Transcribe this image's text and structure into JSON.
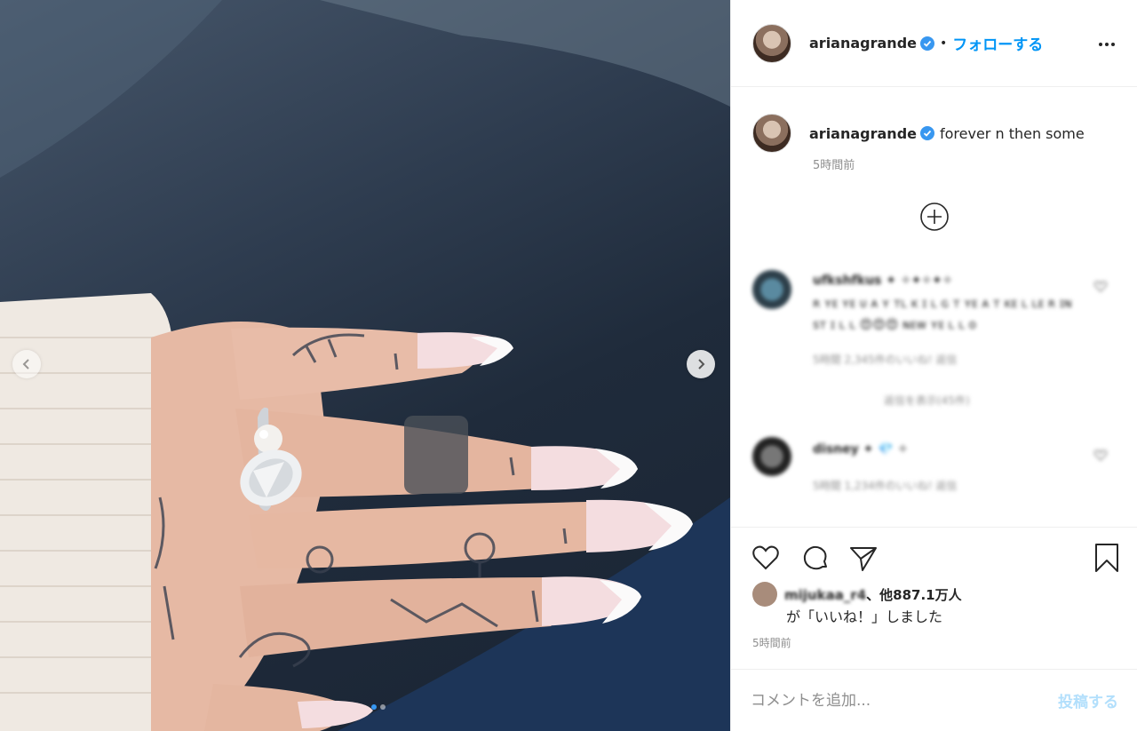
{
  "post": {
    "author": "arianagrande",
    "bullet": "•",
    "follow_label": "フォローする",
    "caption": "forever n then some",
    "caption_time": "5時間前"
  },
  "comments": [
    {
      "user": "ufkshfkus ✦ ✧✦✧✦✧",
      "text": "ʀ ʏᴇ ʏᴇ ᴜ ᴀ ʏ ᴛʟ ᴋ ɪ ʟ ɢ ᴛ ʏᴇ ᴀ ᴛ ᴋᴇ ʟ ʟᴇ ʀ ɪɴ ꜱᴛ ɪ ʟ ʟ 😍😍😍 ɴᴇᴡ ʏᴇ ʟ ʟ ᴏ",
      "meta": "5時間  2,345件のいいね!  返信",
      "replies": "返信を表示(45件)"
    },
    {
      "user": "disney ✦ 💎 ✧",
      "meta": "5時間  1,234件のいいね!  返信"
    }
  ],
  "likes": {
    "liker": "mijukaa_r4",
    "suffix": "、他887.1万人",
    "line2": "が「いいね！」しました",
    "time": "5時間前"
  },
  "comment_box": {
    "placeholder": "コメントを追加...",
    "post_label": "投稿する"
  },
  "colors": {
    "accent": "#0095f6",
    "verified": "#3897f0",
    "muted": "#8e8e8e"
  },
  "icons": [
    "verified-badge-icon",
    "more-options-icon",
    "plus-circle-icon",
    "heart-icon",
    "comment-icon",
    "share-icon",
    "bookmark-icon",
    "chevron-left-icon",
    "chevron-right-icon"
  ]
}
